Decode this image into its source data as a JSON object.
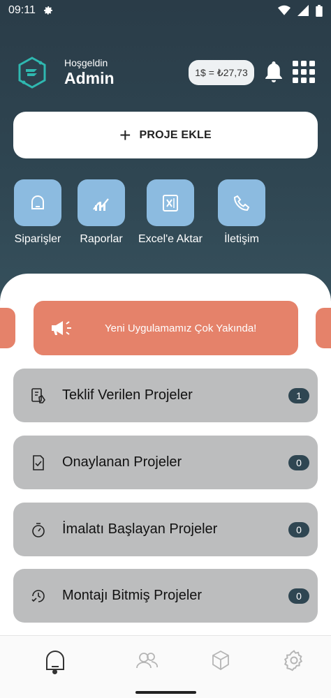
{
  "status_bar": {
    "time": "09:11"
  },
  "header": {
    "welcome": "Hoşgeldin",
    "username": "Admin",
    "exchange_rate": "1$ = ₺27,73"
  },
  "add_project": {
    "label": "PROJE EKLE"
  },
  "quick_actions": [
    {
      "label": "Siparişler",
      "icon": "order-icon"
    },
    {
      "label": "Raporlar",
      "icon": "chart-icon"
    },
    {
      "label": "Excel'e Aktar",
      "icon": "excel-icon"
    },
    {
      "label": "İletişim",
      "icon": "phone-icon"
    }
  ],
  "banner": {
    "text": "Yeni Uygulamamız Çok Yakında!"
  },
  "project_cards": [
    {
      "title": "Teklif Verilen Projeler",
      "count": "1",
      "icon": "document-hand-icon"
    },
    {
      "title": "Onaylanan Projeler",
      "count": "0",
      "icon": "document-check-icon"
    },
    {
      "title": "İmalatı Başlayan Projeler",
      "count": "0",
      "icon": "stopwatch-icon"
    },
    {
      "title": "Montajı Bitmiş Projeler",
      "count": "0",
      "icon": "history-check-icon"
    }
  ],
  "bottom_nav": [
    {
      "name": "home",
      "icon": "home-icon",
      "active": true
    },
    {
      "name": "users",
      "icon": "users-icon",
      "active": false
    },
    {
      "name": "products",
      "icon": "cube-icon",
      "active": false
    },
    {
      "name": "settings",
      "icon": "gear-icon",
      "active": false
    }
  ],
  "colors": {
    "header_bg": "#2f4652",
    "tile_blue": "#8cbbe0",
    "banner_orange": "#e5826a",
    "card_gray": "#bcbdbe",
    "badge_dark": "#2f4652"
  }
}
